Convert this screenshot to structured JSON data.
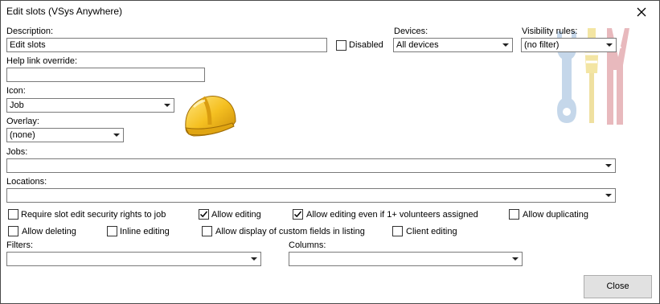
{
  "window": {
    "title": "Edit slots (VSys Anywhere)"
  },
  "description": {
    "label": "Description:",
    "value": "Edit slots"
  },
  "disabled": {
    "label": "Disabled",
    "checked": false
  },
  "devices": {
    "label": "Devices:",
    "value": "All devices"
  },
  "visibility": {
    "label": "Visibility rules:",
    "value": "(no filter)"
  },
  "help_link": {
    "label": "Help link override:",
    "value": ""
  },
  "icon": {
    "label": "Icon:",
    "value": "Job",
    "preview_icon": "hard-hat-icon"
  },
  "overlay": {
    "label": "Overlay:",
    "value": "(none)"
  },
  "jobs": {
    "label": "Jobs:",
    "value": ""
  },
  "locations": {
    "label": "Locations:",
    "value": ""
  },
  "options": [
    {
      "label": "Require slot edit security rights to job",
      "checked": false
    },
    {
      "label": "Allow editing",
      "checked": true
    },
    {
      "label": "Allow editing even if 1+ volunteers assigned",
      "checked": true
    },
    {
      "label": "Allow duplicating",
      "checked": false
    },
    {
      "label": "Allow deleting",
      "checked": false
    },
    {
      "label": "Inline editing",
      "checked": false
    },
    {
      "label": "Allow display of custom fields in listing",
      "checked": false
    },
    {
      "label": "Client editing",
      "checked": false
    }
  ],
  "filters": {
    "label": "Filters:",
    "value": ""
  },
  "columns": {
    "label": "Columns:",
    "value": ""
  },
  "close_button": {
    "label": "Close"
  },
  "decor": {
    "watermark_icon": "tools-icon",
    "colors": {
      "blue": "#c5d7ea",
      "yellow": "#f3e5a3",
      "red": "#e8b9bd"
    }
  }
}
